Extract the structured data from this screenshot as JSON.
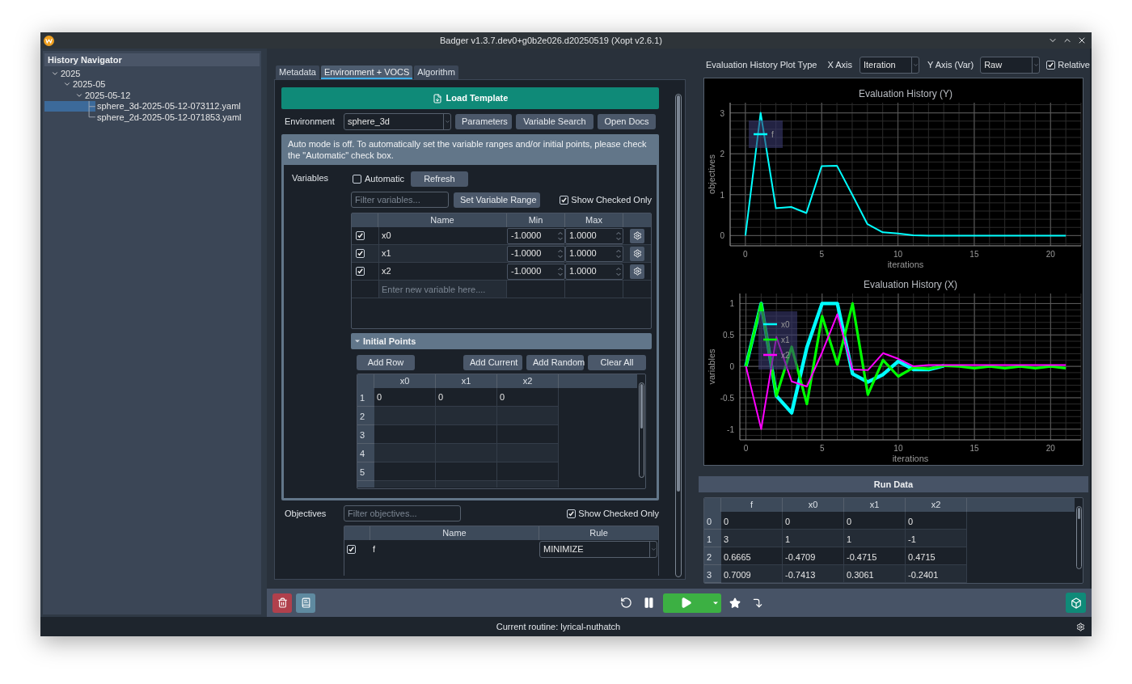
{
  "window": {
    "title": "Badger v1.3.7.dev0+g0b2e026.d20250519 (Xopt v2.6.1)"
  },
  "history": {
    "title": "History Navigator",
    "tree": [
      {
        "label": "2025",
        "expanded": true,
        "children": [
          {
            "label": "2025-05",
            "expanded": true,
            "children": [
              {
                "label": "2025-05-12",
                "expanded": true,
                "children": [
                  {
                    "label": "sphere_3d-2025-05-12-073112.yaml",
                    "selected": true
                  },
                  {
                    "label": "sphere_2d-2025-05-12-071853.yaml",
                    "selected": false
                  }
                ]
              }
            ]
          }
        ]
      }
    ]
  },
  "tabs": [
    {
      "label": "Metadata",
      "selected": false
    },
    {
      "label": "Environment + VOCS",
      "selected": true
    },
    {
      "label": "Algorithm",
      "selected": false
    }
  ],
  "load_template": "Load Template",
  "environment": {
    "label": "Environment",
    "value": "sphere_3d",
    "buttons": [
      "Parameters",
      "Variable Search",
      "Open Docs"
    ]
  },
  "notice": "Auto mode is off.  To automatically set the variable ranges and/or initial points,  please check the \"Automatic\" check box.",
  "variables": {
    "label": "Variables",
    "automatic": {
      "label": "Automatic",
      "checked": false
    },
    "refresh": "Refresh",
    "filter_placeholder": "Filter variables...",
    "set_range": "Set Variable Range",
    "show_checked": {
      "label": "Show Checked Only",
      "checked": true
    },
    "columns": [
      "Name",
      "Min",
      "Max"
    ],
    "rows": [
      {
        "checked": true,
        "name": "x0",
        "min": "-1.0000",
        "max": "1.0000"
      },
      {
        "checked": true,
        "name": "x1",
        "min": "-1.0000",
        "max": "1.0000"
      },
      {
        "checked": true,
        "name": "x2",
        "min": "-1.0000",
        "max": "1.0000"
      }
    ],
    "new_placeholder": "Enter new variable here...."
  },
  "initial_points": {
    "title": "Initial Points",
    "expanded": true,
    "buttons": [
      "Add Row",
      "Add Current",
      "Add Random",
      "Clear All"
    ],
    "columns": [
      "x0",
      "x1",
      "x2"
    ],
    "rows": [
      {
        "index": "1",
        "cells": [
          "0",
          "0",
          "0"
        ]
      },
      {
        "index": "2",
        "cells": []
      },
      {
        "index": "3",
        "cells": []
      },
      {
        "index": "4",
        "cells": []
      },
      {
        "index": "5",
        "cells": []
      }
    ]
  },
  "objectives": {
    "label": "Objectives",
    "filter_placeholder": "Filter objectives...",
    "show_checked": {
      "label": "Show Checked Only",
      "checked": true
    },
    "columns": [
      "Name",
      "Rule"
    ],
    "rows": [
      {
        "checked": true,
        "name": "f",
        "rule": "MINIMIZE"
      }
    ]
  },
  "plot_controls": {
    "plot_type_label": "Evaluation History Plot Type",
    "x_axis_label": "X Axis",
    "x_axis_value": "Iteration",
    "y_axis_label": "Y Axis (Var)",
    "y_axis_value": "Raw",
    "relative": {
      "label": "Relative",
      "checked": true
    }
  },
  "plots": [
    {
      "chart_data": {
        "type": "line",
        "title": "Evaluation History (Y)",
        "xlabel": "iterations",
        "ylabel": "objectives",
        "grid": true,
        "legend": true,
        "x": [
          0,
          1,
          2,
          3,
          4,
          5,
          6,
          7,
          8,
          9,
          10,
          11,
          12,
          13,
          14,
          15,
          16,
          17,
          18,
          19,
          20,
          21
        ],
        "xlim": [
          -1,
          22
        ],
        "ylim": [
          -0.25,
          3.25
        ],
        "xticks": [
          0,
          5,
          10,
          15,
          20
        ],
        "yticks": [
          0,
          1,
          2,
          3
        ],
        "series": [
          {
            "name": "f",
            "color": "#00ffff",
            "values": [
              0,
              3,
              0.67,
              0.7,
              0.55,
              1.7,
              1.71,
              1.0,
              0.28,
              0.08,
              0.05,
              0.01,
              0,
              0,
              0,
              0,
              0,
              0,
              0,
              0,
              0,
              0
            ]
          }
        ]
      }
    },
    {
      "chart_data": {
        "type": "line",
        "title": "Evaluation History (X)",
        "xlabel": "iterations",
        "ylabel": "variables",
        "grid": true,
        "legend": true,
        "x": [
          0,
          1,
          2,
          3,
          4,
          5,
          6,
          7,
          8,
          9,
          10,
          11,
          12,
          13,
          14,
          15,
          16,
          17,
          18,
          19,
          20,
          21
        ],
        "xlim": [
          -0.4,
          22
        ],
        "ylim": [
          -1.17,
          1.16
        ],
        "xticks": [
          0,
          5,
          10,
          15,
          20
        ],
        "yticks": [
          -1,
          -0.5,
          0,
          0.5,
          1
        ],
        "series": [
          {
            "name": "x0",
            "color": "#00ffff",
            "values": [
              0,
              1,
              -0.47,
              -0.74,
              0.3,
              1,
              1,
              -0.12,
              -0.25,
              -0.13,
              0.08,
              -0.05,
              -0.05,
              0.01,
              null,
              null,
              null,
              null,
              null,
              null,
              null,
              null
            ]
          },
          {
            "name": "x1",
            "color": "#00ff00",
            "values": [
              0,
              1,
              -0.47,
              0.31,
              -0.6,
              0.8,
              0.03,
              1,
              -0.45,
              0.1,
              -0.16,
              -0.02,
              -0.04,
              0.01,
              0,
              -0.03,
              0,
              -0.03,
              0,
              -0.03,
              0,
              -0.03
            ]
          },
          {
            "name": "x2",
            "color": "#ff00ff",
            "values": [
              0,
              -1,
              0.47,
              -0.24,
              -0.32,
              0.22,
              0.83,
              -0.05,
              -0.06,
              0.21,
              0.12,
              0,
              0.02,
              0.02,
              0.02,
              0.02,
              0.02,
              0.02,
              0.02,
              0.02,
              0.02,
              0.02
            ]
          }
        ]
      }
    }
  ],
  "run_data": {
    "title": "Run Data",
    "columns": [
      "f",
      "x0",
      "x1",
      "x2"
    ],
    "rows": [
      {
        "index": "0",
        "cells": [
          "0",
          "0",
          "0",
          "0"
        ]
      },
      {
        "index": "1",
        "cells": [
          "3",
          "1",
          "1",
          "-1"
        ]
      },
      {
        "index": "2",
        "cells": [
          "0.6665",
          "-0.4709",
          "-0.4715",
          "0.4715"
        ]
      },
      {
        "index": "3",
        "cells": [
          "0.7009",
          "-0.7413",
          "0.3061",
          "-0.2401"
        ]
      }
    ]
  },
  "status_bar": {
    "text": "Current routine: lyrical-nuthatch"
  }
}
